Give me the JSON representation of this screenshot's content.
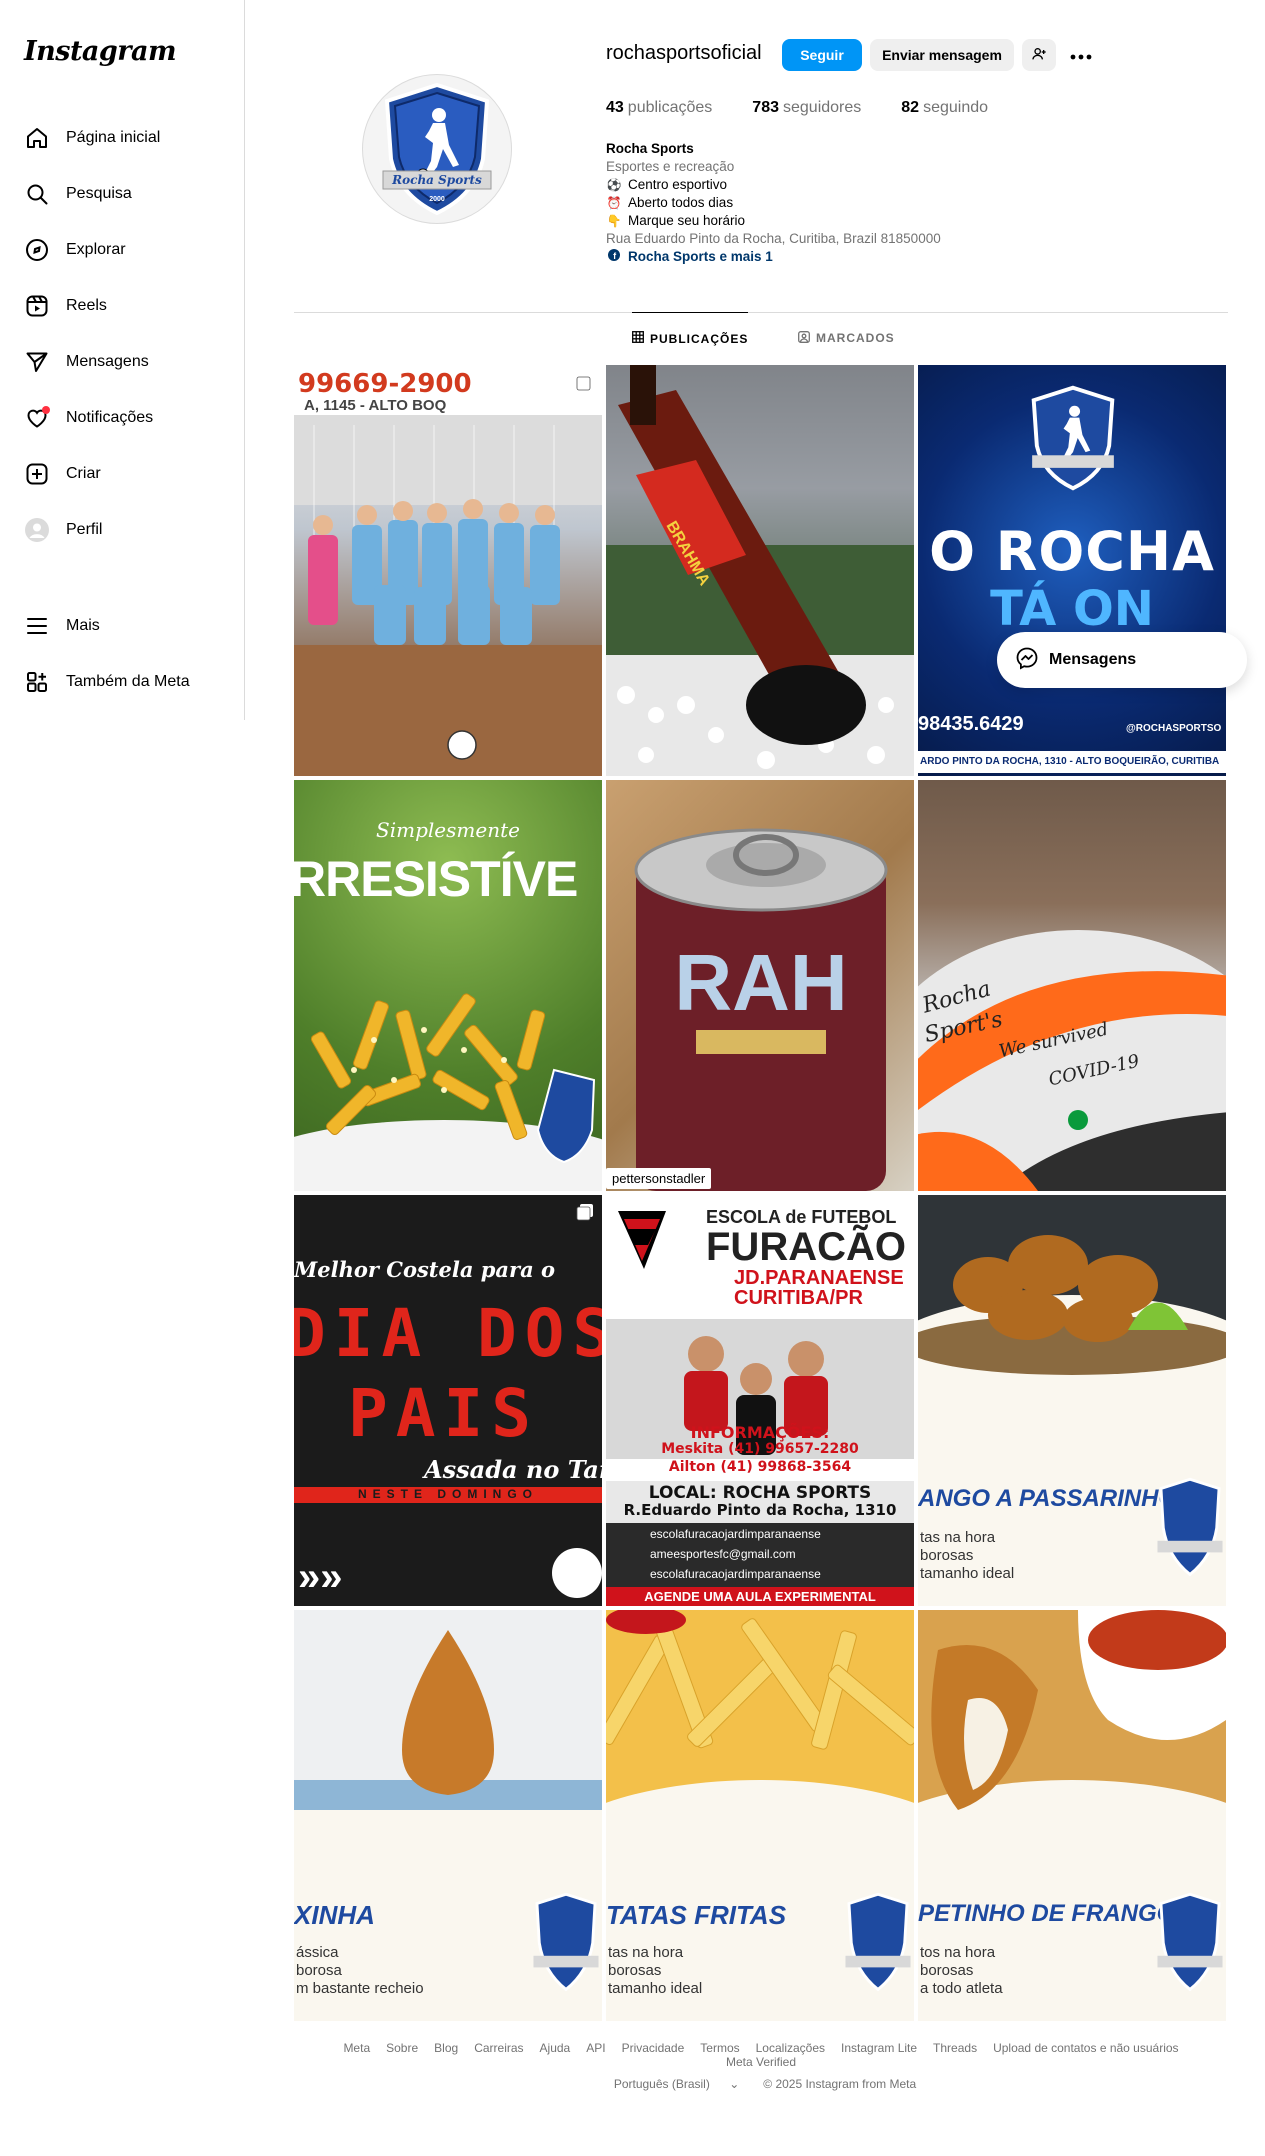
{
  "app": {
    "logo": "Instagram"
  },
  "sidebar": {
    "items": [
      {
        "label": "Página inicial",
        "icon": "home-icon"
      },
      {
        "label": "Pesquisa",
        "icon": "search-icon"
      },
      {
        "label": "Explorar",
        "icon": "compass-icon"
      },
      {
        "label": "Reels",
        "icon": "reels-icon"
      },
      {
        "label": "Mensagens",
        "icon": "messenger-icon"
      },
      {
        "label": "Notificações",
        "icon": "heart-icon"
      },
      {
        "label": "Criar",
        "icon": "plus-square-icon"
      },
      {
        "label": "Perfil",
        "icon": "profile-avatar-icon"
      }
    ],
    "more": {
      "label": "Mais",
      "icon": "menu-icon"
    },
    "meta": {
      "label": "Também da Meta",
      "icon": "grid-apps-icon"
    }
  },
  "profile": {
    "username": "rochasportsoficial",
    "follow_label": "Seguir",
    "message_label": "Enviar mensagem",
    "posts_count": "43",
    "posts_label": "publicações",
    "followers_count": "783",
    "followers_label": "seguidores",
    "following_count": "82",
    "following_label": "seguindo",
    "full_name": "Rocha Sports",
    "category": "Esportes e recreação",
    "bio_lines": [
      "Centro esportivo",
      "Aberto todos dias",
      "Marque seu horário"
    ],
    "address": "Rua Eduardo Pinto da Rocha, Curitiba, Brazil 81850000",
    "link": "Rocha Sports e mais 1",
    "avatar_text": "Rocha Sports",
    "avatar_year": "2000"
  },
  "tabs": {
    "posts": "PUBLICAÇÕES",
    "tagged": "MARCADOS"
  },
  "posts": [
    {
      "alt": "Equipe de futsal feminino",
      "top_text": "99669-2900",
      "sub_text": "A, 1145 - ALTO BOQ"
    },
    {
      "alt": "Garrafa de Brahma no gelo"
    },
    {
      "alt": "O Rocha tá on",
      "headline": "O ROCHA",
      "sub": "TÁ ON",
      "phone": "98435.6429",
      "social": "@ROCHASPORTSO",
      "footer": "ARDO PINTO DA ROCHA, 1310 - ALTO BOQUEIRÃO, CURITIBA"
    },
    {
      "alt": "Batata irresistível",
      "script": "Simplesmente",
      "headline": "RRESISTÍVE"
    },
    {
      "alt": "Lata de Brahma Duplo Malte",
      "tag": "pettersonstadler"
    },
    {
      "alt": "Bola de futsal autografada",
      "note1": "Rocha",
      "note2": "Sport's",
      "note3": "We survived",
      "note4": "COVID-19"
    },
    {
      "alt": "Costela Dia dos Pais",
      "line1": "Melhor Costela para o",
      "line2": "DIA DOS",
      "line3": "PAIS",
      "line4": "Assada no Tam",
      "line5": "NESTE DOMINGO"
    },
    {
      "alt": "Escola de futebol Furacão",
      "title1": "ESCOLA de FUTEBOL",
      "title2": "FURACÃO",
      "title3": "JD.PARANAENSE",
      "title4": "CURITIBA/PR",
      "info": "INFORMAÇÕES:",
      "c1": "Meskita (41) 99657-2280",
      "c2": "Ailton (41) 99868-3564",
      "local": "LOCAL: ROCHA SPORTS",
      "addr": "R.Eduardo Pinto da Rocha, 1310",
      "s1": "escolafuracaojardimparanaense",
      "s2": "ameesportesfc@gmail.com",
      "s3": "escolafuracaojardimparanaense",
      "cta": "AGENDE UMA AULA EXPERIMENTAL"
    },
    {
      "alt": "Frango a passarinho",
      "headline": "ANGO A PASSARINHO",
      "l1": "tas na hora",
      "l2": "borosas",
      "l3": "tamanho ideal"
    },
    {
      "alt": "Coxinha",
      "headline": "XINHA",
      "l1": "ássica",
      "l2": "borosa",
      "l3": "m bastante recheio"
    },
    {
      "alt": "Batatas fritas",
      "headline": "TATAS FRITAS",
      "l1": "tas na hora",
      "l2": "borosas",
      "l3": "tamanho ideal"
    },
    {
      "alt": "Petinho de frango",
      "headline": "PETINHO DE FRANGO",
      "l1": "tos na hora",
      "l2": "borosas",
      "l3": "a todo atleta"
    }
  ],
  "floating": {
    "label": "Mensagens"
  },
  "footer": {
    "links": [
      "Meta",
      "Sobre",
      "Blog",
      "Carreiras",
      "Ajuda",
      "API",
      "Privacidade",
      "Termos",
      "Localizações",
      "Instagram Lite",
      "Threads",
      "Upload de contatos e não usuários",
      "Meta Verified"
    ],
    "language": "Português (Brasil)",
    "copyright": "© 2025 Instagram from Meta"
  },
  "colors": {
    "accent": "#0095f6",
    "link": "#00376b",
    "muted": "#737373",
    "notif": "#ff3040"
  }
}
